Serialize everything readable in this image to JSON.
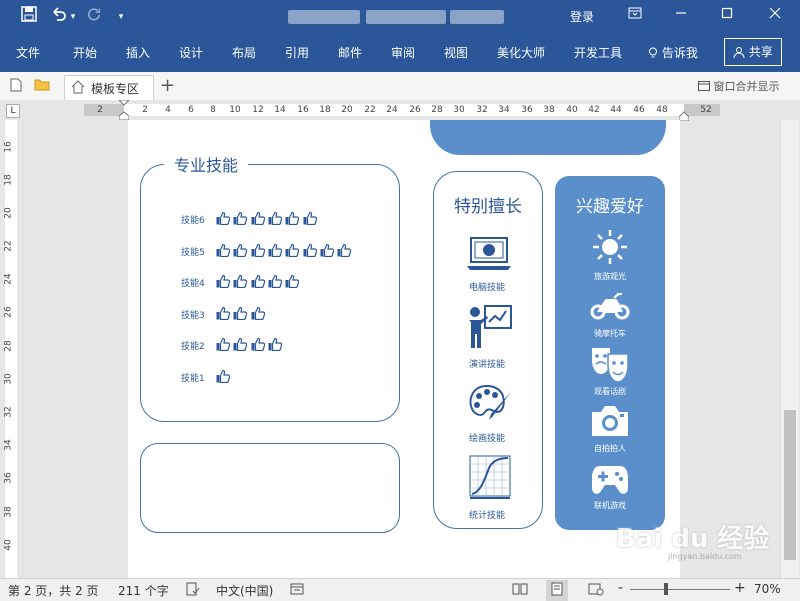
{
  "titlebar": {
    "login": "登录",
    "undo_arrow": "▾",
    "customize": "▾"
  },
  "ribbon": {
    "menus": [
      "文件",
      "开始",
      "插入",
      "设计",
      "布局",
      "引用",
      "邮件",
      "审阅",
      "视图",
      "美化大师",
      "开发工具"
    ],
    "tell_me": "告诉我",
    "share": "共享"
  },
  "tabbar": {
    "tab_label": "模板专区",
    "add": "+",
    "merge": "窗口合并显示"
  },
  "ruler": {
    "ticks": [
      "2",
      "2",
      "4",
      "6",
      "8",
      "10",
      "12",
      "14",
      "16",
      "18",
      "20",
      "22",
      "24",
      "26",
      "28",
      "30",
      "32",
      "34",
      "36",
      "38",
      "40",
      "42",
      "44",
      "46",
      "48",
      "52"
    ],
    "vticks": [
      "16",
      "18",
      "20",
      "22",
      "24",
      "26",
      "28",
      "30",
      "32",
      "34",
      "36",
      "38",
      "40"
    ]
  },
  "document": {
    "skills_title": "专业技能",
    "skills": [
      {
        "label": "技能6",
        "count": 6
      },
      {
        "label": "技能5",
        "count": 8
      },
      {
        "label": "技能4",
        "count": 5
      },
      {
        "label": "技能3",
        "count": 3
      },
      {
        "label": "技能2",
        "count": 4
      },
      {
        "label": "技能1",
        "count": 1
      }
    ],
    "talents_title": "特别擅长",
    "talents": [
      {
        "label": "电脑技能",
        "icon": "laptop-icon"
      },
      {
        "label": "演讲技能",
        "icon": "presenter-icon"
      },
      {
        "label": "绘画技能",
        "icon": "palette-icon"
      },
      {
        "label": "统计技能",
        "icon": "chart-icon"
      }
    ],
    "hobbies_title": "兴趣爱好",
    "hobbies": [
      {
        "label": "旅游观光",
        "icon": "sun-icon"
      },
      {
        "label": "骑摩托车",
        "icon": "motorcycle-icon"
      },
      {
        "label": "观看话剧",
        "icon": "theater-masks-icon"
      },
      {
        "label": "自拍拍人",
        "icon": "camera-icon"
      },
      {
        "label": "联机游戏",
        "icon": "gamepad-icon"
      }
    ]
  },
  "status": {
    "page": "第 2 页，共 2 页",
    "words": "211 个字",
    "language": "中文(中国)",
    "zoom": "70%",
    "zoom_minus": "-",
    "zoom_plus": "+"
  },
  "watermark": {
    "text": "Bai du 经验",
    "sub": "jingyan.baidu.com"
  },
  "colors": {
    "word_blue": "#2b579a",
    "accent_blue": "#5b8fcb",
    "outline_blue": "#4472a8"
  }
}
